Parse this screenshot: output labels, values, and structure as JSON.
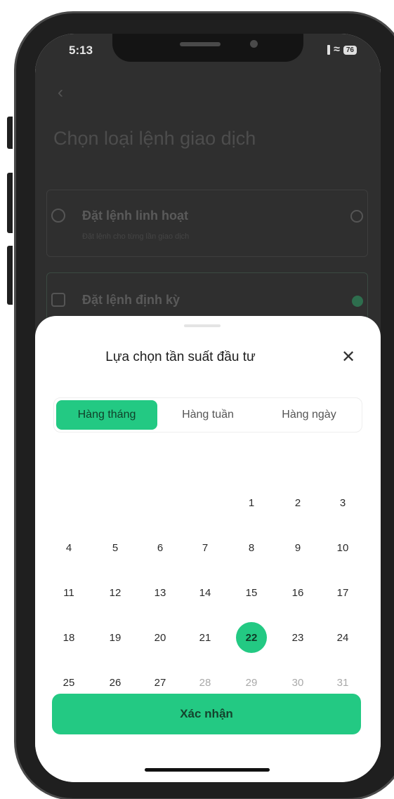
{
  "status_bar": {
    "time": "5:13",
    "battery": "76"
  },
  "background": {
    "page_title": "Chọn loại lệnh giao dịch",
    "options": [
      {
        "title": "Đặt lệnh linh hoạt",
        "subtitle": "Đặt lệnh cho từng lần giao dịch",
        "selected": false
      },
      {
        "title": "Đặt lệnh định kỳ",
        "selected": true
      }
    ]
  },
  "sheet": {
    "title": "Lựa chọn tần suất đầu tư",
    "tabs": [
      {
        "label": "Hàng tháng",
        "active": true
      },
      {
        "label": "Hàng tuần",
        "active": false
      },
      {
        "label": "Hàng ngày",
        "active": false
      }
    ],
    "days": [
      "1",
      "2",
      "3",
      "4",
      "5",
      "6",
      "7",
      "8",
      "9",
      "10",
      "11",
      "12",
      "13",
      "14",
      "15",
      "16",
      "17",
      "18",
      "19",
      "20",
      "21",
      "22",
      "23",
      "24",
      "25",
      "26",
      "27",
      "28",
      "29",
      "30",
      "31"
    ],
    "selected_day": "22",
    "muted_days": [
      "28",
      "29",
      "30",
      "31"
    ],
    "confirm_label": "Xác nhận"
  },
  "colors": {
    "accent": "#23c983",
    "dim_bg": "#2f2f2f"
  },
  "icons": {
    "back": "chevron-left-icon",
    "close": "close-icon",
    "wifi": "wifi-icon",
    "signal": "signal-icon",
    "battery": "battery-icon"
  }
}
